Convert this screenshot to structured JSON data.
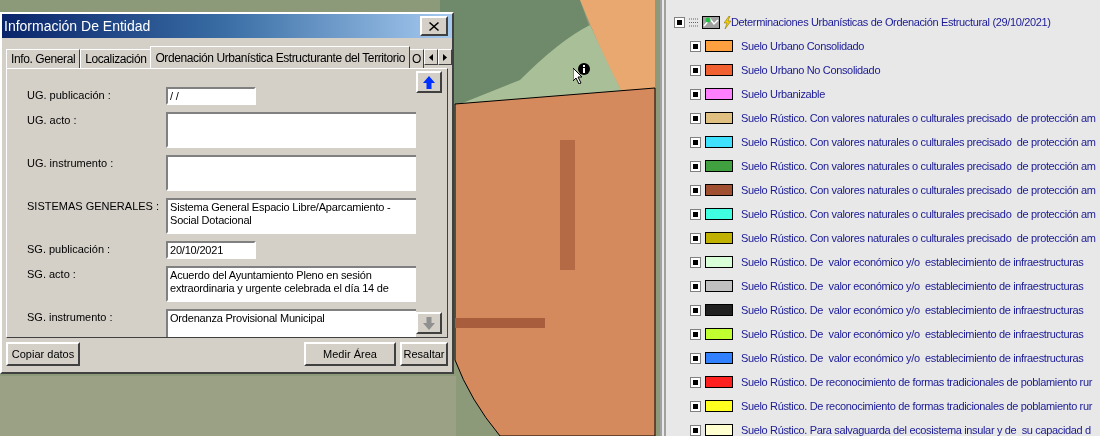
{
  "dialog": {
    "title": "Información De Entidad",
    "tabs": [
      {
        "label": "Info. General",
        "selected": false
      },
      {
        "label": "Localización",
        "selected": false
      },
      {
        "label": "Ordenación Urbanística Estructurante del Territorio",
        "selected": true
      },
      {
        "label": "O",
        "selected": false
      }
    ],
    "fields": [
      {
        "label": "UG. publicación :",
        "value": "/ /",
        "kind": "single"
      },
      {
        "label": "UG. acto :",
        "kind": "multi"
      },
      {
        "label": "UG. instrumento :",
        "kind": "multi"
      },
      {
        "label": "SISTEMAS GENERALES :",
        "value": "Sistema General Espacio Libre/Aparcamiento - Social Dotacional",
        "kind": "multi"
      },
      {
        "label": "SG. publicación :",
        "value": "20/10/2021",
        "kind": "single"
      },
      {
        "label": "SG. acto :",
        "value": "Acuerdo del Ayuntamiento Pleno en sesión extraordinaria y urgente celebrada el día 14 de",
        "kind": "multi"
      },
      {
        "label": "SG. instrumento :",
        "value": "Ordenanza Provisional Municipal",
        "kind": "multi"
      }
    ],
    "buttons": [
      {
        "label": "Copiar datos"
      },
      {
        "label": "Medir Área"
      },
      {
        "label": "Resaltar"
      }
    ]
  },
  "legend": {
    "group": {
      "label": "Determinaciones Urbanísticas de Ordenación Estructural (29/10/2021)",
      "checked": true
    },
    "items": [
      {
        "label": "Suelo Urbano Consolidado",
        "checked": true,
        "color": "#ffa040"
      },
      {
        "label": "Suelo Urbano No Consolidado",
        "checked": true,
        "color": "#f06030"
      },
      {
        "label": "Suelo Urbanizable",
        "checked": true,
        "color": "#ff80ff"
      },
      {
        "label": "Suelo Rústico. Con valores naturales o culturales precisado  de protección am",
        "checked": true,
        "color": "#e0c080"
      },
      {
        "label": "Suelo Rústico. Con valores naturales o culturales precisado  de protección am",
        "checked": true,
        "color": "#40e0ff"
      },
      {
        "label": "Suelo Rústico. Con valores naturales o culturales precisado  de protección am",
        "checked": true,
        "color": "#40a040"
      },
      {
        "label": "Suelo Rústico. Con valores naturales o culturales precisado  de protección am",
        "checked": true,
        "color": "#a05030"
      },
      {
        "label": "Suelo Rústico. Con valores naturales o culturales precisado  de protección am",
        "checked": true,
        "color": "#40ffe0"
      },
      {
        "label": "Suelo Rústico. Con valores naturales o culturales precisado  de protección am",
        "checked": true,
        "color": "#c0b000"
      },
      {
        "label": "Suelo Rústico. De  valor económico y/o  establecimiento de infraestructuras",
        "checked": true,
        "color": "#d8ffd8"
      },
      {
        "label": "Suelo Rústico. De  valor económico y/o  establecimiento de infraestructuras",
        "checked": true,
        "color": "#c0c0c0"
      },
      {
        "label": "Suelo Rústico. De  valor económico y/o  establecimiento de infraestructuras",
        "checked": true,
        "color": "#202020"
      },
      {
        "label": "Suelo Rústico. De  valor económico y/o  establecimiento de infraestructuras",
        "checked": true,
        "color": "#c0ff30"
      },
      {
        "label": "Suelo Rústico. De  valor económico y/o  establecimiento de infraestructuras",
        "checked": true,
        "color": "#3080ff"
      },
      {
        "label": "Suelo Rústico. De reconocimiento de formas tradicionales de poblamiento rur",
        "checked": true,
        "color": "#ff2020"
      },
      {
        "label": "Suelo Rústico. De reconocimiento de formas tradicionales de poblamiento rur",
        "checked": true,
        "color": "#ffff20"
      },
      {
        "label": "Suelo Rústico. Para salvaguarda del ecosistema insular y de  su capacidad d",
        "checked": true,
        "color": "#ffffd0"
      }
    ]
  }
}
